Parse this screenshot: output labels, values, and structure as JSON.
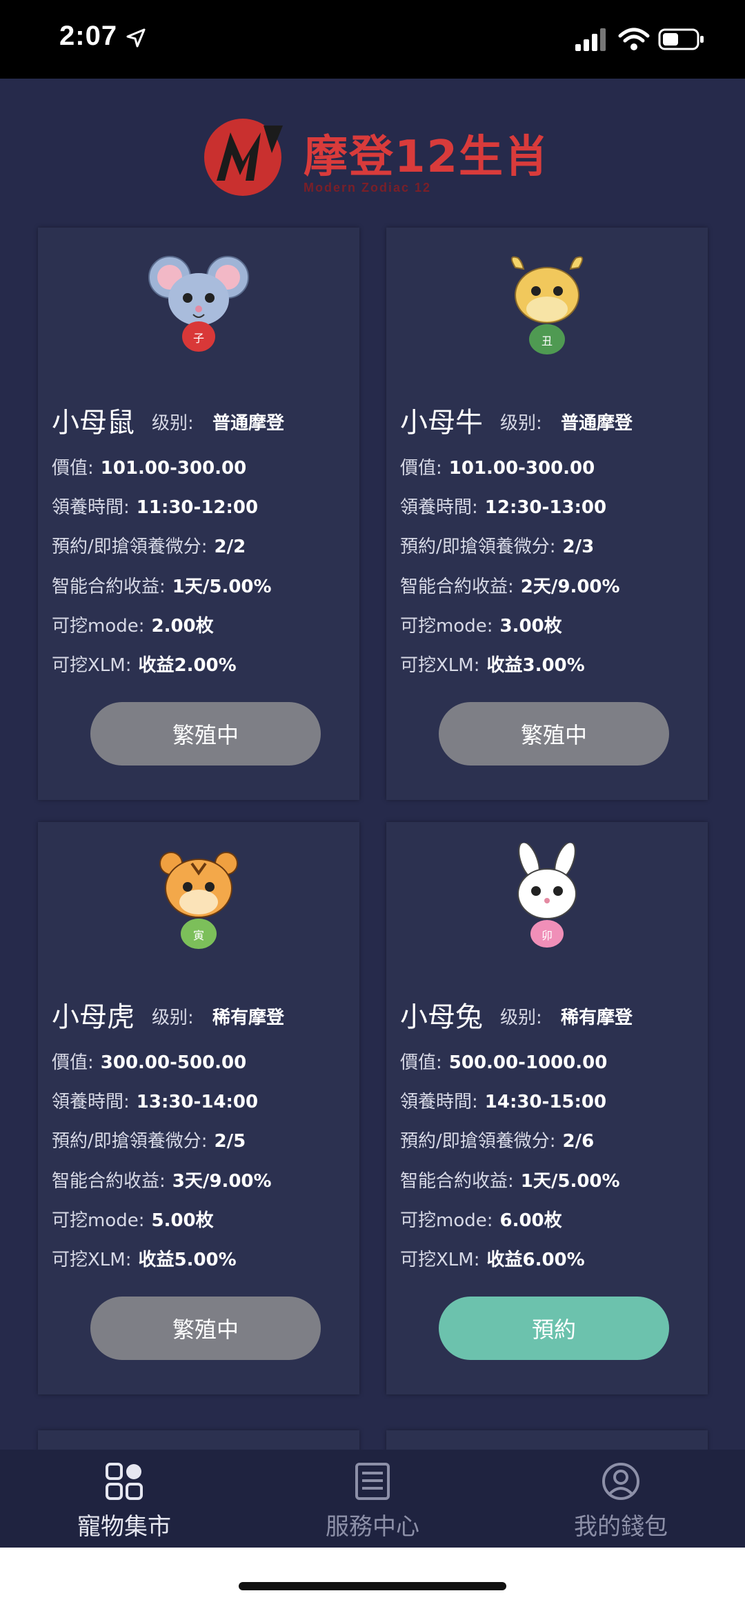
{
  "status_bar": {
    "time": "2:07"
  },
  "header": {
    "title": "摩登12生肖",
    "subtitle": "Modern Zodiac 12"
  },
  "labels": {
    "level": "级别:",
    "value": "價值:",
    "time": "領養時間:",
    "points": "預約/即搶領養微分:",
    "yield": "智能合約收益:",
    "mode": "可挖mode:",
    "xlm": "可挖XLM:"
  },
  "pets": [
    {
      "name": "小母鼠",
      "level": "普通摩登",
      "value": "101.00-300.00",
      "time": "11:30-12:00",
      "points": "2/2",
      "yield": "1天/5.00%",
      "mode": "2.00枚",
      "xlm": "收益2.00%",
      "button": "繁殖中",
      "animal": "rat",
      "badge": "子"
    },
    {
      "name": "小母牛",
      "level": "普通摩登",
      "value": "101.00-300.00",
      "time": "12:30-13:00",
      "points": "2/3",
      "yield": "2天/9.00%",
      "mode": "3.00枚",
      "xlm": "收益3.00%",
      "button": "繁殖中",
      "animal": "ox",
      "badge": "丑"
    },
    {
      "name": "小母虎",
      "level": "稀有摩登",
      "value": "300.00-500.00",
      "time": "13:30-14:00",
      "points": "2/5",
      "yield": "3天/9.00%",
      "mode": "5.00枚",
      "xlm": "收益5.00%",
      "button": "繁殖中",
      "animal": "tiger",
      "badge": "寅"
    },
    {
      "name": "小母兔",
      "level": "稀有摩登",
      "value": "500.00-1000.00",
      "time": "14:30-15:00",
      "points": "2/6",
      "yield": "1天/5.00%",
      "mode": "6.00枚",
      "xlm": "收益6.00%",
      "button": "預約",
      "animal": "rabbit",
      "badge": "卯"
    }
  ],
  "tabs": [
    {
      "label": "寵物集市",
      "icon": "grid-icon",
      "active": true
    },
    {
      "label": "服務中心",
      "icon": "document-icon",
      "active": false
    },
    {
      "label": "我的錢包",
      "icon": "user-icon",
      "active": false
    }
  ],
  "colors": {
    "background": "#262a4b",
    "card": "#2c3150",
    "button_busy": "#7e7f86",
    "button_reserve": "#6cc2ad",
    "brand": "#d93b3b"
  }
}
